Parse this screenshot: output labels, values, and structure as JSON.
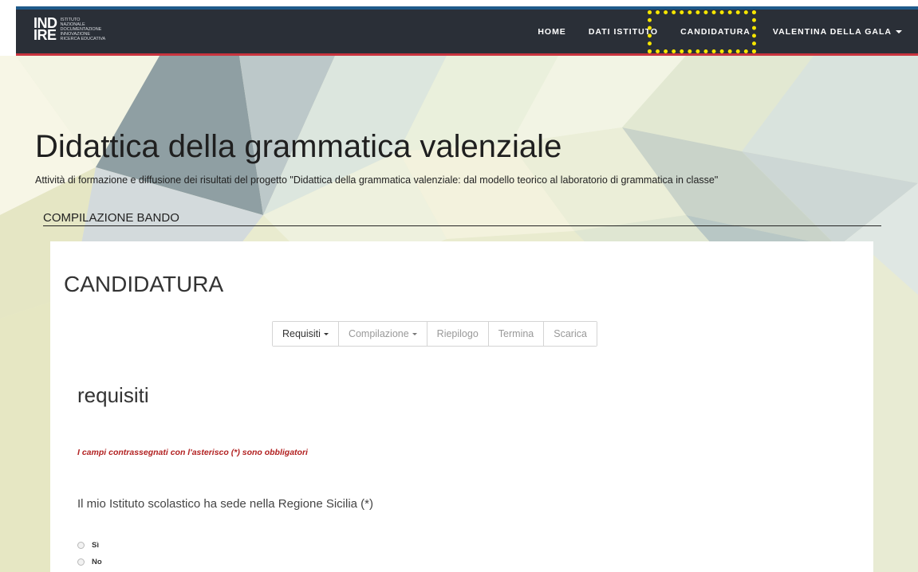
{
  "navbar": {
    "logo_mark_top": "IND",
    "logo_mark_bottom": "IRE",
    "logo_text_lines": [
      "ISTITUTO",
      "NAZIONALE",
      "DOCUMENTAZIONE",
      "INNOVAZIONE",
      "RICERCA EDUCATIVA"
    ],
    "items": {
      "home": "HOME",
      "dati_istituto": "DATI ISTITUTO",
      "candidatura": "CANDIDATURA",
      "user": "VALENTINA DELLA GALA"
    }
  },
  "hero": {
    "title": "Didattica della grammatica valenziale",
    "subtitle": "Attività di formazione e diffusione dei risultati del progetto \"Didattica della grammatica valenziale: dal modello teorico al laboratorio di grammatica in classe\"",
    "section_label": "COMPILAZIONE BANDO"
  },
  "card": {
    "title": "CANDIDATURA",
    "steps": {
      "requisiti": "Requisiti",
      "compilazione": "Compilazione",
      "riepilogo": "Riepilogo",
      "termina": "Termina",
      "scarica": "Scarica"
    },
    "section_heading": "requisiti",
    "required_note": "I campi contrassegnati con l'asterisco (*) sono obbligatori",
    "question": "Il mio Istituto scolastico ha sede nella Regione Sicilia (*)",
    "options": {
      "yes": "Sì",
      "no": "No"
    }
  },
  "colors": {
    "navbar_bg": "#2a2f37",
    "navbar_border_top": "#1f5a8a",
    "navbar_border_bottom": "#c9343e",
    "highlight": "#f5e500",
    "required_note": "#b22222",
    "hero_bg": "#eceecf"
  }
}
